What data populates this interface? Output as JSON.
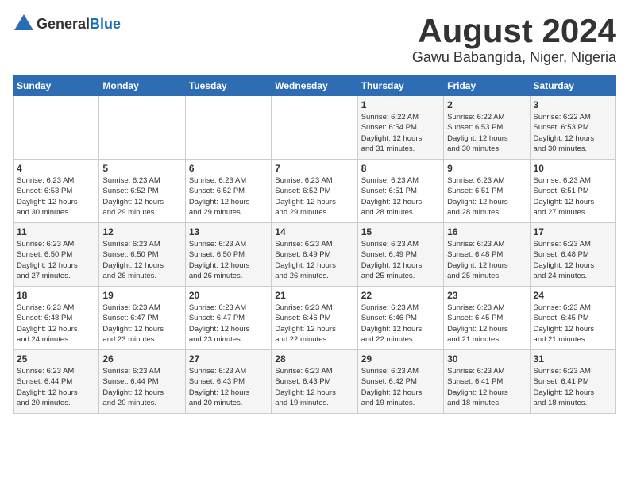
{
  "header": {
    "logo_general": "General",
    "logo_blue": "Blue",
    "month_year": "August 2024",
    "location": "Gawu Babangida, Niger, Nigeria"
  },
  "days_of_week": [
    "Sunday",
    "Monday",
    "Tuesday",
    "Wednesday",
    "Thursday",
    "Friday",
    "Saturday"
  ],
  "weeks": [
    [
      {
        "day": "",
        "info": ""
      },
      {
        "day": "",
        "info": ""
      },
      {
        "day": "",
        "info": ""
      },
      {
        "day": "",
        "info": ""
      },
      {
        "day": "1",
        "info": "Sunrise: 6:22 AM\nSunset: 6:54 PM\nDaylight: 12 hours\nand 31 minutes."
      },
      {
        "day": "2",
        "info": "Sunrise: 6:22 AM\nSunset: 6:53 PM\nDaylight: 12 hours\nand 30 minutes."
      },
      {
        "day": "3",
        "info": "Sunrise: 6:22 AM\nSunset: 6:53 PM\nDaylight: 12 hours\nand 30 minutes."
      }
    ],
    [
      {
        "day": "4",
        "info": "Sunrise: 6:23 AM\nSunset: 6:53 PM\nDaylight: 12 hours\nand 30 minutes."
      },
      {
        "day": "5",
        "info": "Sunrise: 6:23 AM\nSunset: 6:52 PM\nDaylight: 12 hours\nand 29 minutes."
      },
      {
        "day": "6",
        "info": "Sunrise: 6:23 AM\nSunset: 6:52 PM\nDaylight: 12 hours\nand 29 minutes."
      },
      {
        "day": "7",
        "info": "Sunrise: 6:23 AM\nSunset: 6:52 PM\nDaylight: 12 hours\nand 29 minutes."
      },
      {
        "day": "8",
        "info": "Sunrise: 6:23 AM\nSunset: 6:51 PM\nDaylight: 12 hours\nand 28 minutes."
      },
      {
        "day": "9",
        "info": "Sunrise: 6:23 AM\nSunset: 6:51 PM\nDaylight: 12 hours\nand 28 minutes."
      },
      {
        "day": "10",
        "info": "Sunrise: 6:23 AM\nSunset: 6:51 PM\nDaylight: 12 hours\nand 27 minutes."
      }
    ],
    [
      {
        "day": "11",
        "info": "Sunrise: 6:23 AM\nSunset: 6:50 PM\nDaylight: 12 hours\nand 27 minutes."
      },
      {
        "day": "12",
        "info": "Sunrise: 6:23 AM\nSunset: 6:50 PM\nDaylight: 12 hours\nand 26 minutes."
      },
      {
        "day": "13",
        "info": "Sunrise: 6:23 AM\nSunset: 6:50 PM\nDaylight: 12 hours\nand 26 minutes."
      },
      {
        "day": "14",
        "info": "Sunrise: 6:23 AM\nSunset: 6:49 PM\nDaylight: 12 hours\nand 26 minutes."
      },
      {
        "day": "15",
        "info": "Sunrise: 6:23 AM\nSunset: 6:49 PM\nDaylight: 12 hours\nand 25 minutes."
      },
      {
        "day": "16",
        "info": "Sunrise: 6:23 AM\nSunset: 6:48 PM\nDaylight: 12 hours\nand 25 minutes."
      },
      {
        "day": "17",
        "info": "Sunrise: 6:23 AM\nSunset: 6:48 PM\nDaylight: 12 hours\nand 24 minutes."
      }
    ],
    [
      {
        "day": "18",
        "info": "Sunrise: 6:23 AM\nSunset: 6:48 PM\nDaylight: 12 hours\nand 24 minutes."
      },
      {
        "day": "19",
        "info": "Sunrise: 6:23 AM\nSunset: 6:47 PM\nDaylight: 12 hours\nand 23 minutes."
      },
      {
        "day": "20",
        "info": "Sunrise: 6:23 AM\nSunset: 6:47 PM\nDaylight: 12 hours\nand 23 minutes."
      },
      {
        "day": "21",
        "info": "Sunrise: 6:23 AM\nSunset: 6:46 PM\nDaylight: 12 hours\nand 22 minutes."
      },
      {
        "day": "22",
        "info": "Sunrise: 6:23 AM\nSunset: 6:46 PM\nDaylight: 12 hours\nand 22 minutes."
      },
      {
        "day": "23",
        "info": "Sunrise: 6:23 AM\nSunset: 6:45 PM\nDaylight: 12 hours\nand 21 minutes."
      },
      {
        "day": "24",
        "info": "Sunrise: 6:23 AM\nSunset: 6:45 PM\nDaylight: 12 hours\nand 21 minutes."
      }
    ],
    [
      {
        "day": "25",
        "info": "Sunrise: 6:23 AM\nSunset: 6:44 PM\nDaylight: 12 hours\nand 20 minutes."
      },
      {
        "day": "26",
        "info": "Sunrise: 6:23 AM\nSunset: 6:44 PM\nDaylight: 12 hours\nand 20 minutes."
      },
      {
        "day": "27",
        "info": "Sunrise: 6:23 AM\nSunset: 6:43 PM\nDaylight: 12 hours\nand 20 minutes."
      },
      {
        "day": "28",
        "info": "Sunrise: 6:23 AM\nSunset: 6:43 PM\nDaylight: 12 hours\nand 19 minutes."
      },
      {
        "day": "29",
        "info": "Sunrise: 6:23 AM\nSunset: 6:42 PM\nDaylight: 12 hours\nand 19 minutes."
      },
      {
        "day": "30",
        "info": "Sunrise: 6:23 AM\nSunset: 6:41 PM\nDaylight: 12 hours\nand 18 minutes."
      },
      {
        "day": "31",
        "info": "Sunrise: 6:23 AM\nSunset: 6:41 PM\nDaylight: 12 hours\nand 18 minutes."
      }
    ]
  ]
}
